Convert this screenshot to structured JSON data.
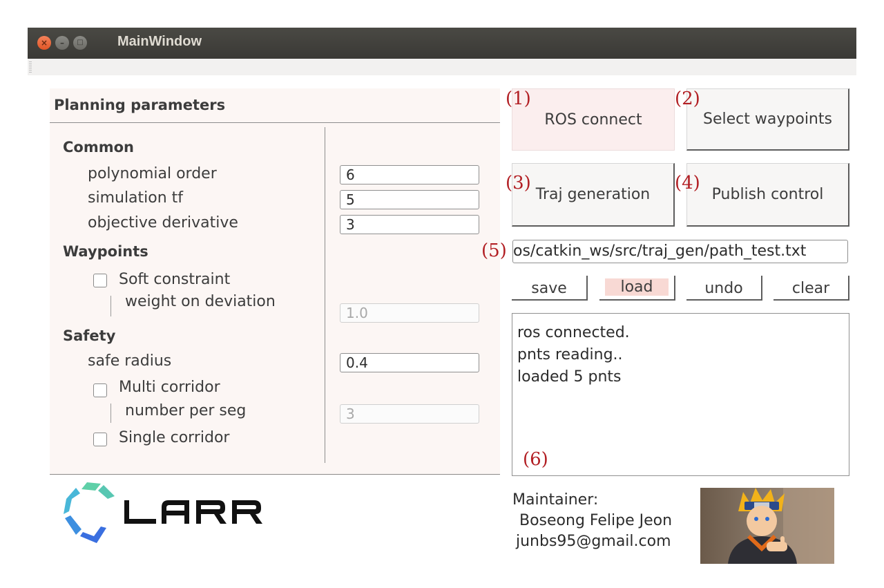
{
  "window": {
    "title": "MainWindow"
  },
  "params": {
    "title": "Planning parameters",
    "common": {
      "heading": "Common",
      "polynomial_order": {
        "label": "polynomial order",
        "value": "6"
      },
      "simulation_tf": {
        "label": "simulation tf",
        "value": "5"
      },
      "objective_derivative": {
        "label": "objective derivative",
        "value": "3"
      }
    },
    "waypoints": {
      "heading": "Waypoints",
      "soft_constraint_label": "Soft constraint",
      "weight_label": "weight on deviation",
      "weight_value": "1.0"
    },
    "safety": {
      "heading": "Safety",
      "safe_radius": {
        "label": "safe radius",
        "value": "0.4"
      },
      "multi_corridor_label": "Multi corridor",
      "number_per_seg_label": "number per seg",
      "number_per_seg_value": "3",
      "single_corridor_label": "Single corridor"
    }
  },
  "logo": {
    "text": "LARR"
  },
  "controls": {
    "ros_connect": "ROS connect",
    "select_waypoints": "Select waypoints",
    "traj_generation": "Traj generation",
    "publish_control": "Publish control",
    "path": "os/catkin_ws/src/traj_gen/path_test.txt",
    "save": "save",
    "load": "load",
    "undo": "undo",
    "clear": "clear"
  },
  "log": [
    "ros connected.",
    "pnts reading..",
    "loaded 5 pnts"
  ],
  "annotations": {
    "a1": "(1)",
    "a2": "(2)",
    "a3": "(3)",
    "a4": "(4)",
    "a5": "(5)",
    "a6": "(6)"
  },
  "maintainer": {
    "label": "Maintainer:",
    "name": " Boseong Felipe Jeon",
    "email": "junbs95@gmail.com"
  },
  "colors": {
    "titlebar": "#3c3b37",
    "close_button": "#e9542a",
    "annotation": "#b21f24",
    "panel_bg": "#fcf6f4",
    "pressed_button_bg": "#fbeeee"
  }
}
